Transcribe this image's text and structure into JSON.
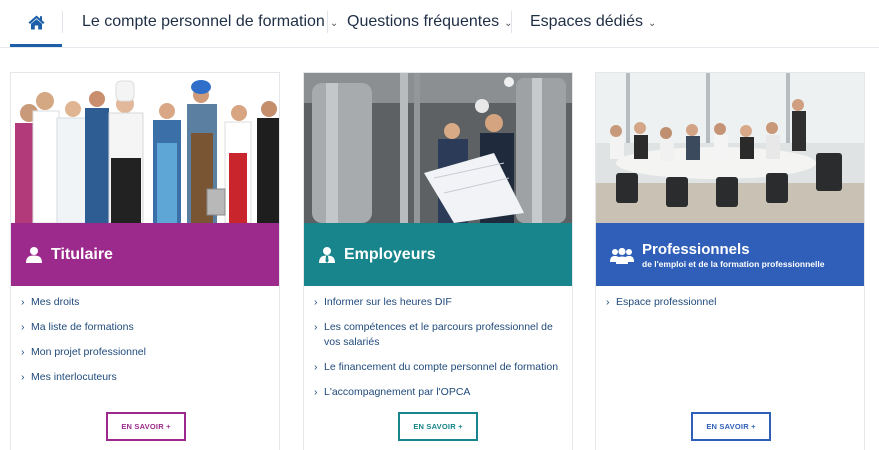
{
  "nav": {
    "items": [
      {
        "label": "Le compte personnel de formation"
      },
      {
        "label": "Questions fréquentes"
      },
      {
        "label": "Espaces dédiés"
      }
    ]
  },
  "colors": {
    "titulaire": "#9c2a8c",
    "employeurs": "#17858b",
    "professionnels": "#2f5fb8",
    "link": "#1f4a7a",
    "nav_active": "#1c5fa8"
  },
  "cards": [
    {
      "title": "Titulaire",
      "links": [
        "Mes droits",
        "Ma liste de formations",
        "Mon projet professionnel",
        "Mes interlocuteurs"
      ],
      "button": "EN SAVOIR +"
    },
    {
      "title": "Employeurs",
      "links": [
        "Informer sur les heures DIF",
        "Les compétences et le parcours professionnel de vos salariés",
        "Le financement du compte personnel de formation",
        "L'accompagnement par l'OPCA"
      ],
      "button": "EN SAVOIR +"
    },
    {
      "title": "Professionnels",
      "subtitle": "de l'emploi et de la formation professionnelle",
      "links": [
        "Espace professionnel"
      ],
      "button": "EN SAVOIR +"
    }
  ],
  "link_marker": "›"
}
